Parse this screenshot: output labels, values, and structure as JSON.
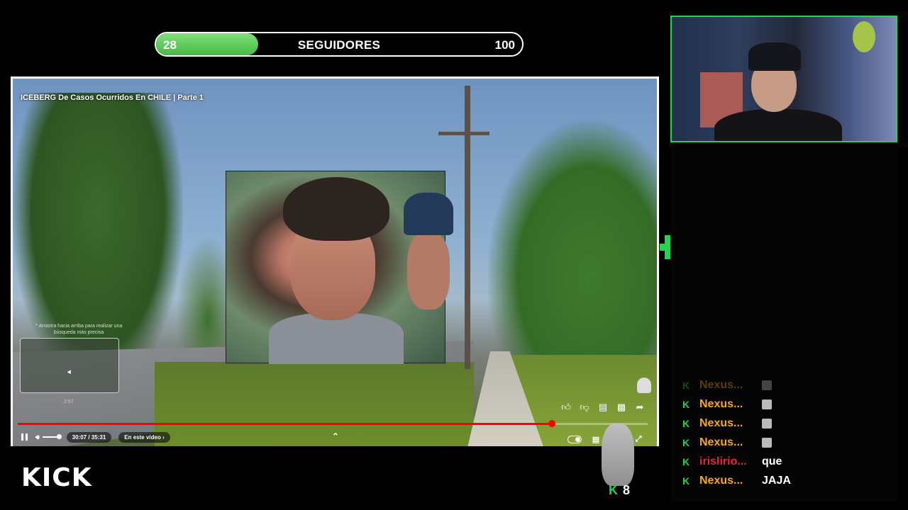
{
  "goal": {
    "current": "28",
    "title": "SEGUIDORES",
    "target": "100",
    "progress": 0.28
  },
  "video": {
    "title": "ICEBERG De Casos Ocurridos En CHILE | Parte 1",
    "thumbnail_hint": "^ Arrastra hacia arriba para realizar una búsqueda más precisa",
    "thumbnail_time": "2:57",
    "time_display": "30:07 / 35:31",
    "chapters_label": "En este video",
    "progress": 0.848,
    "actions": [
      "thumbs-up-icon",
      "thumbs-down-icon",
      "comment-icon",
      "remix-icon",
      "share-icon"
    ]
  },
  "chat": {
    "messages": [
      {
        "user": "Nexus...",
        "text": "",
        "color": "#f5a623",
        "faded": true
      },
      {
        "user": "Nexus...",
        "text": "",
        "color": "#f5a623",
        "faded": false
      },
      {
        "user": "Nexus...",
        "text": "",
        "color": "#f5a623",
        "faded": false
      },
      {
        "user": "Nexus...",
        "text": "",
        "color": "#f5a623",
        "faded": false
      },
      {
        "user": "irislirio...",
        "text": "que",
        "color": "#e8253a",
        "faded": false
      },
      {
        "user": "Nexus...",
        "text": "JAJA",
        "color": "#f5a623",
        "faded": false
      }
    ]
  },
  "branding": {
    "logo": "KICK"
  },
  "viewers": {
    "count": "8"
  },
  "colors": {
    "accent": "#27d34a",
    "progress": "#ff0000"
  }
}
